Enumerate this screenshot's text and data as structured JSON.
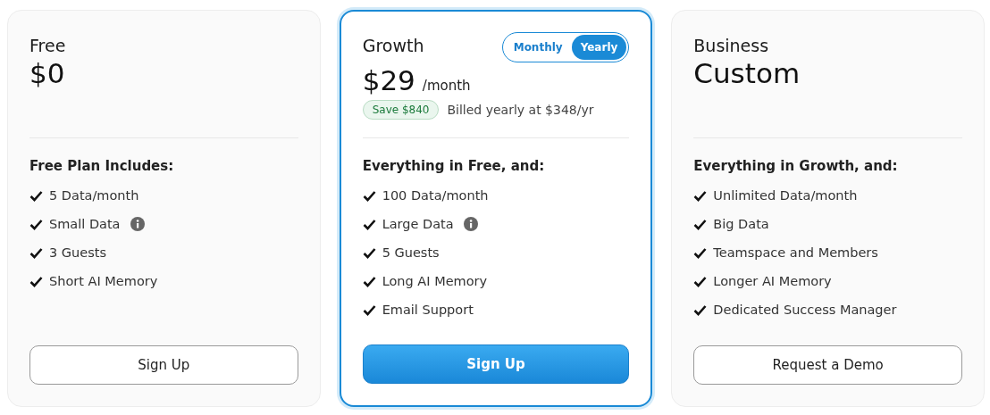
{
  "plans": [
    {
      "name": "Free",
      "price": "$0",
      "featured": false,
      "heading": "Free Plan Includes:",
      "features": [
        {
          "text": "5 Data/month",
          "info": false
        },
        {
          "text": "Small Data",
          "info": true
        },
        {
          "text": "3 Guests",
          "info": false
        },
        {
          "text": "Short AI Memory",
          "info": false
        }
      ],
      "button": "Sign Up"
    },
    {
      "name": "Growth",
      "price": "$29",
      "unit": "/month",
      "featured": true,
      "billing": [
        {
          "label": "Monthly",
          "selected": false
        },
        {
          "label": "Yearly",
          "selected": true
        }
      ],
      "badge": "Save $840",
      "note": "Billed yearly at $348/yr",
      "heading": "Everything in Free, and:",
      "features": [
        {
          "text": "100 Data/month",
          "info": false
        },
        {
          "text": "Large Data",
          "info": true
        },
        {
          "text": "5 Guests",
          "info": false
        },
        {
          "text": "Long AI Memory",
          "info": false
        },
        {
          "text": "Email Support",
          "info": false
        }
      ],
      "button": "Sign Up"
    },
    {
      "name": "Business",
      "price": "Custom",
      "featured": false,
      "heading": "Everything in Growth, and:",
      "features": [
        {
          "text": "Unlimited Data/month",
          "info": false
        },
        {
          "text": "Big Data",
          "info": false
        },
        {
          "text": "Teamspace and Members",
          "info": false
        },
        {
          "text": "Longer AI Memory",
          "info": false
        },
        {
          "text": "Dedicated Success Manager",
          "info": false
        }
      ],
      "button": "Request a Demo"
    }
  ]
}
